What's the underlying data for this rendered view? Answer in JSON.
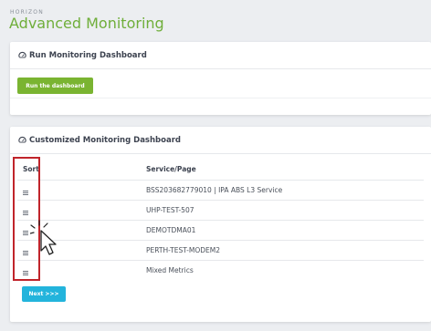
{
  "header": {
    "brand": "HORIZON",
    "title": "Advanced Monitoring"
  },
  "run_card": {
    "title": "Run Monitoring Dashboard",
    "button_label": "Run the dashboard"
  },
  "custom_card": {
    "title": "Customized Monitoring Dashboard",
    "columns": [
      "Sort",
      "Service/Page"
    ],
    "rows": [
      {
        "service": "BSS203682779010 | IPA ABS L3 Service"
      },
      {
        "service": "UHP-TEST-507"
      },
      {
        "service": "DEMOTDMA01"
      },
      {
        "service": "PERTH-TEST-MODEM2"
      },
      {
        "service": "Mixed Metrics"
      }
    ],
    "next_label": "Next >>>"
  },
  "colors": {
    "title": "#6fae3a",
    "run_button": "#7ab431",
    "next_button": "#23b4dc",
    "highlight": "#c0242b"
  },
  "icons": [
    "gauge-icon",
    "drag-handle-icon",
    "pointer-cursor-icon"
  ]
}
